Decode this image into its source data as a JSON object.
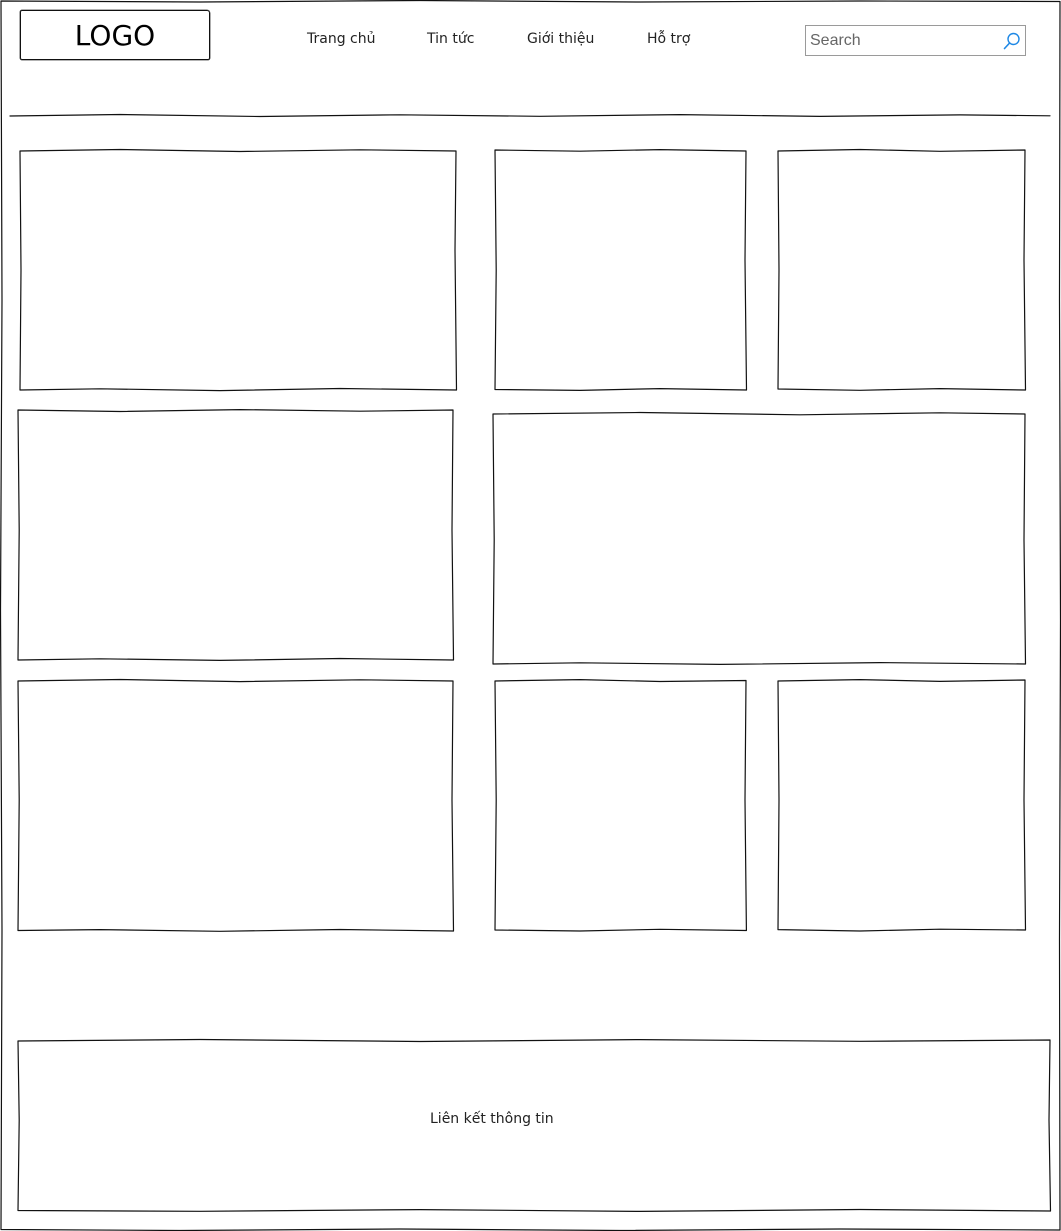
{
  "header": {
    "logo_text": "LOGO",
    "nav": [
      {
        "label": "Trang chủ"
      },
      {
        "label": "Tin tức"
      },
      {
        "label": "Giới thiệu"
      },
      {
        "label": "Hỗ trợ"
      }
    ],
    "search": {
      "placeholder": "Search",
      "value": ""
    }
  },
  "footer": {
    "text": "Liên kết thông tin"
  },
  "colors": {
    "stroke": "#111111",
    "search_icon": "#1e88e5",
    "search_border": "#9a9a9a",
    "background": "#ffffff"
  },
  "icons": {
    "search": "search-icon"
  }
}
